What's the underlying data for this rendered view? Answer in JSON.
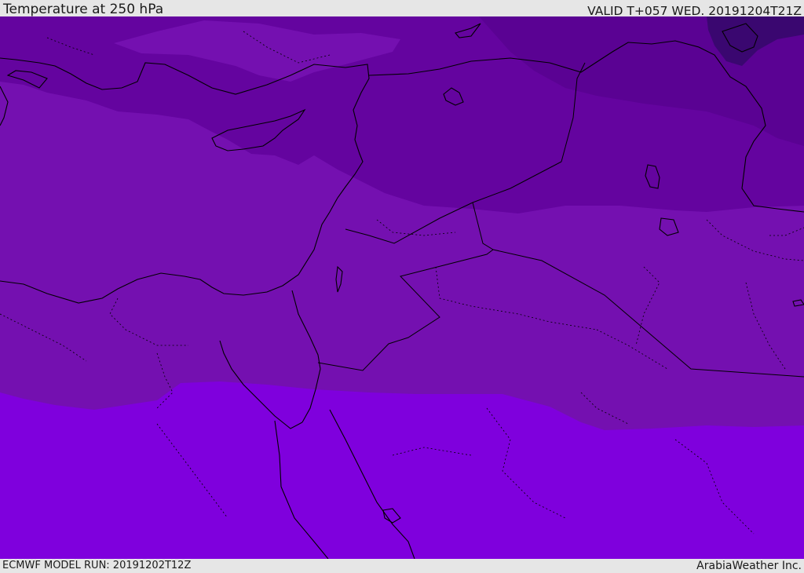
{
  "header": {
    "title": "Temperature at 250 hPa",
    "valid": "VALID T+057 WED. 20191204T21Z"
  },
  "footer": {
    "model_run": "ECMWF MODEL RUN: 20191202T12Z",
    "credit": "ArabiaWeather Inc."
  },
  "map": {
    "variable": "Temperature at 250 hPa",
    "region": "Eastern Mediterranean / Middle East",
    "fill_colors": {
      "darkest": "#3a0770",
      "dark": "#5a0293",
      "medium_dark": "#64049f",
      "medium": "#7410b0",
      "light": "#7f00dd"
    },
    "line_color": "#000000"
  }
}
